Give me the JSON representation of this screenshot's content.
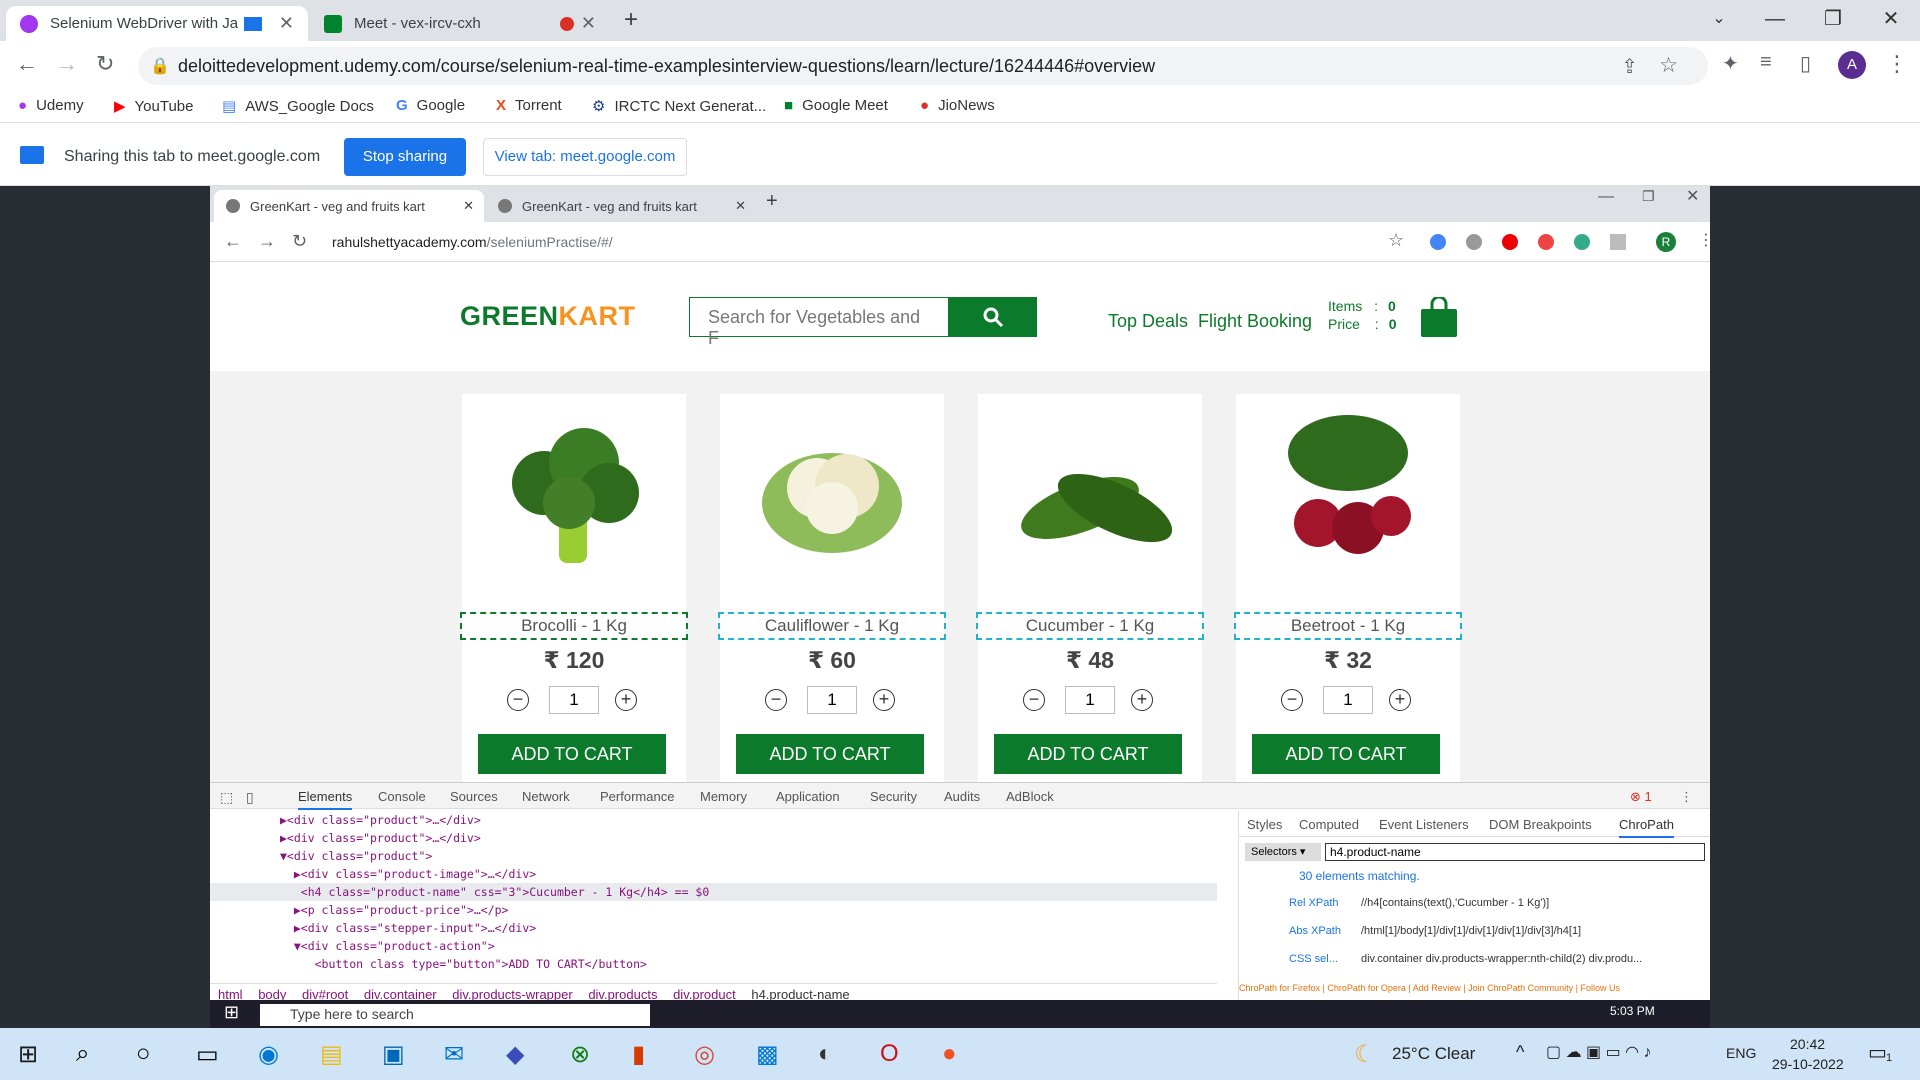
{
  "browser": {
    "tabs": [
      {
        "title": "Selenium WebDriver with Ja"
      },
      {
        "title": "Meet - vex-ircv-cxh"
      }
    ],
    "url": "deloittedevelopment.udemy.com/course/selenium-real-time-examplesinterview-questions/learn/lecture/16244446#overview",
    "profile": "A",
    "bookmarks": [
      "Udemy",
      "YouTube",
      "AWS_Google Docs",
      "Google",
      "Torrent",
      "IRCTC Next Generat...",
      "Google Meet",
      "JioNews"
    ]
  },
  "sharebar": {
    "text": "Sharing this tab to meet.google.com",
    "stop": "Stop sharing",
    "view": "View tab: meet.google.com"
  },
  "inner": {
    "tabs": [
      "GreenKart - veg and fruits kart",
      "GreenKart - veg and fruits kart"
    ],
    "url_host": "rahulshettyacademy.com",
    "url_path": "/seleniumPractise/#/",
    "profile": "R"
  },
  "site": {
    "logo_a": "GREEN",
    "logo_b": "KART",
    "search_placeholder": "Search for Vegetables and F",
    "top_deals": "Top Deals",
    "flight": "Flight Booking",
    "items_label": "Items",
    "price_label": "Price",
    "colon": ":",
    "items": "0",
    "price": "0",
    "products": [
      {
        "name": "Brocolli - 1 Kg",
        "price": "₹ 120",
        "qty": "1",
        "btn": "ADD TO CART"
      },
      {
        "name": "Cauliflower - 1 Kg",
        "price": "₹ 60",
        "qty": "1",
        "btn": "ADD TO CART"
      },
      {
        "name": "Cucumber - 1 Kg",
        "price": "₹ 48",
        "qty": "1",
        "btn": "ADD TO CART"
      },
      {
        "name": "Beetroot - 1 Kg",
        "price": "₹ 32",
        "qty": "1",
        "btn": "ADD TO CART"
      }
    ]
  },
  "devtools": {
    "tabs": [
      "Elements",
      "Console",
      "Sources",
      "Network",
      "Performance",
      "Memory",
      "Application",
      "Security",
      "Audits",
      "AdBlock"
    ],
    "errors": "1",
    "code": [
      "▶<div class=\"product\">…</div>",
      "▶<div class=\"product\">…</div>",
      "▼<div class=\"product\">",
      "  ▶<div class=\"product-image\">…</div>",
      "   <h4 class=\"product-name\" css=\"3\">Cucumber - 1 Kg</h4> == $0",
      "  ▶<p class=\"product-price\">…</p>",
      "  ▶<div class=\"stepper-input\">…</div>",
      "  ▼<div class=\"product-action\">",
      "     <button class type=\"button\">ADD TO CART</button>"
    ],
    "breadcrumbs": [
      "html",
      "body",
      "div#root",
      "div.container",
      "div.products-wrapper",
      "div.products",
      "div.product",
      "h4.product-name"
    ],
    "side_tabs": [
      "Styles",
      "Computed",
      "Event Listeners",
      "DOM Breakpoints",
      "ChroPath"
    ],
    "selector_type": "Selectors",
    "selector_value": "h4.product-name",
    "matching": "30 elements matching.",
    "rows": [
      {
        "label": "Rel XPath",
        "value": "//h4[contains(text(),'Cucumber - 1 Kg')]"
      },
      {
        "label": "Abs XPath",
        "value": "/html[1]/body[1]/div[1]/div[1]/div[1]/div[3]/h4[1]"
      },
      {
        "label": "CSS sel...",
        "value": "div.container div.products-wrapper:nth-child(2) div.produ..."
      }
    ],
    "footer": "ChroPath for Firefox | ChroPath for Opera | Add Review | Join ChroPath Community | Follow Us"
  },
  "inner_taskbar": {
    "search": "Type here to search",
    "time": "5:03 PM"
  },
  "taskbar": {
    "weather": "25°C  Clear",
    "lang": "ENG",
    "time": "20:42",
    "date": "29-10-2022",
    "notif": "1"
  },
  "colors": {
    "green": "#0c7a2b",
    "orange": "#f7931e",
    "accent": "#1a73e8"
  }
}
